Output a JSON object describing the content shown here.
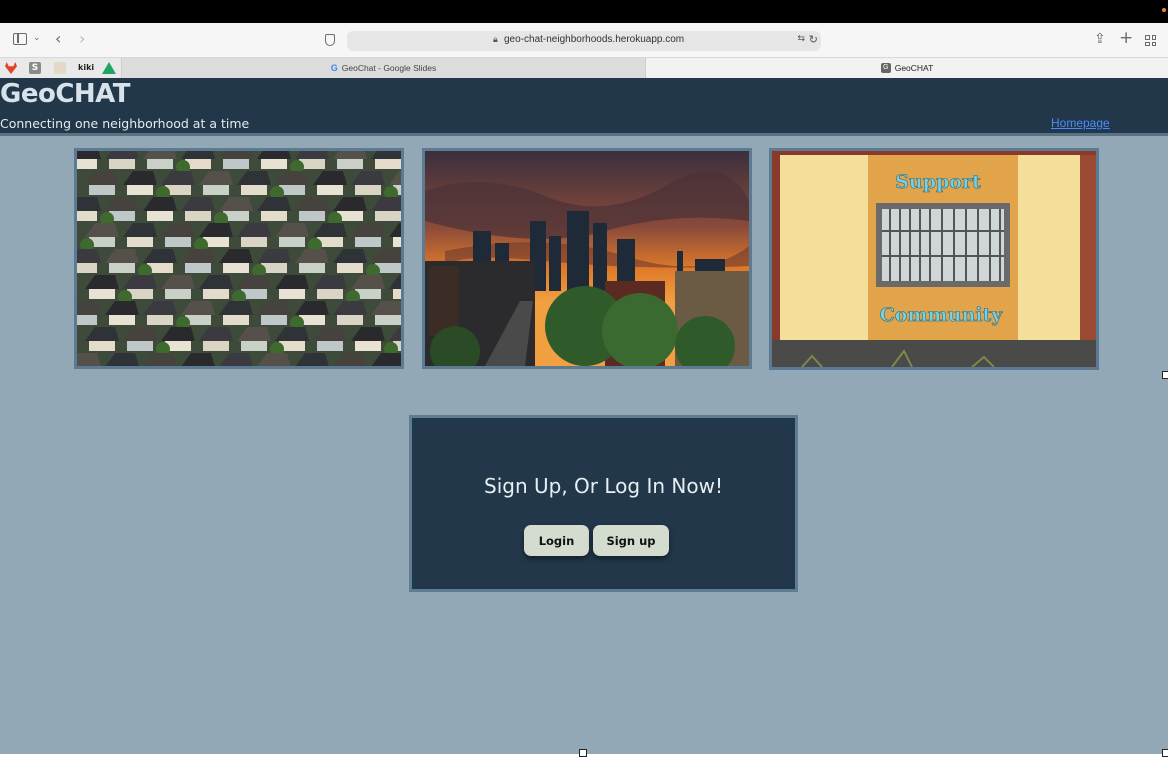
{
  "browser": {
    "url": "geo-chat-neighborhoods.herokuapp.com",
    "tabs": [
      {
        "label": "GeoChat - Google Slides",
        "active": false
      },
      {
        "label": "GeoCHAT",
        "active": true
      }
    ],
    "favorites": [
      "gitlab-icon",
      "s-icon",
      "notes-icon",
      "kiki-icon",
      "google-drive-icon"
    ],
    "favorites_text": {
      "s": "S",
      "kiki": "kiki"
    },
    "tab_favicons": {
      "slides": "G",
      "geochat": "G"
    }
  },
  "header": {
    "title": "GeoCHAT",
    "tagline": "Connecting one neighborhood at a time",
    "homepage_link": "Homepage"
  },
  "photos": {
    "photo_3_text_top": "Support",
    "photo_3_text_bottom": "Community"
  },
  "signup": {
    "title": "Sign Up, Or Log In Now!",
    "login_label": "Login",
    "signup_label": "Sign up"
  },
  "colors": {
    "header_bg": "#22384a",
    "page_bg": "#93a8b6",
    "button_bg": "#d4dbcf",
    "link": "#4a8bff"
  }
}
